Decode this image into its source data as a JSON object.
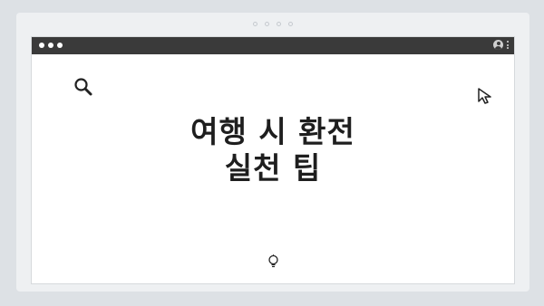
{
  "carousel": {
    "dots": 4
  },
  "slide": {
    "title_line1": "여행 시 환전",
    "title_line2": "실천 팁"
  },
  "icons": {
    "top_left": "search-icon",
    "top_right": "cursor-arrow-icon",
    "bottom": "lightbulb-icon",
    "titlebar_user": "user-avatar-icon",
    "titlebar_menu": "more-vertical-icon"
  },
  "colors": {
    "background": "#dde1e5",
    "frame": "#eef0f2",
    "titlebar": "#3a3a3a",
    "window": "#ffffff",
    "title_text": "#1e1e1e"
  }
}
